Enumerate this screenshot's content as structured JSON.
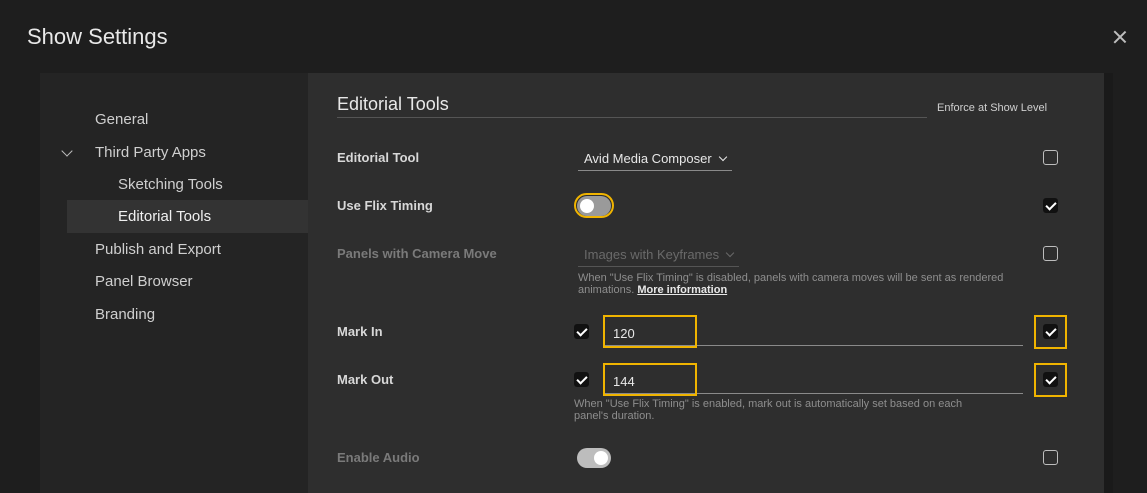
{
  "dialog": {
    "title": "Show Settings"
  },
  "sidebar": {
    "items": [
      {
        "label": "General"
      },
      {
        "label": "Third Party Apps"
      },
      {
        "label": "Sketching Tools"
      },
      {
        "label": "Editorial Tools"
      },
      {
        "label": "Publish and Export"
      },
      {
        "label": "Panel Browser"
      },
      {
        "label": "Branding"
      }
    ]
  },
  "section": {
    "title": "Editorial Tools",
    "enforce_label": "Enforce at Show Level"
  },
  "rows": {
    "editorial_tool": {
      "label": "Editorial Tool",
      "value": "Avid Media Composer",
      "enforce": false
    },
    "use_flix_timing": {
      "label": "Use Flix Timing",
      "on": false,
      "enforce": true
    },
    "panels_camera_move": {
      "label": "Panels with Camera Move",
      "value": "Images with Keyframes",
      "helper": "When \"Use Flix Timing\" is disabled, panels with camera moves will be sent as rendered",
      "helper_line2": "animations.",
      "helper_link": "More information",
      "enforce": false
    },
    "mark_in": {
      "label": "Mark In",
      "value": "120",
      "enabled": true,
      "enforce": true
    },
    "mark_out": {
      "label": "Mark Out",
      "value": "144",
      "enabled": true,
      "enforce": true,
      "helper": "When \"Use Flix Timing\" is enabled, mark out is automatically set based on each",
      "helper_line2": "panel's duration."
    },
    "enable_audio": {
      "label": "Enable Audio",
      "on": true,
      "enforce": false
    }
  },
  "colors": {
    "highlight": "#f0b400",
    "background": "#1e1e1e",
    "panel": "#2e2e2e"
  }
}
